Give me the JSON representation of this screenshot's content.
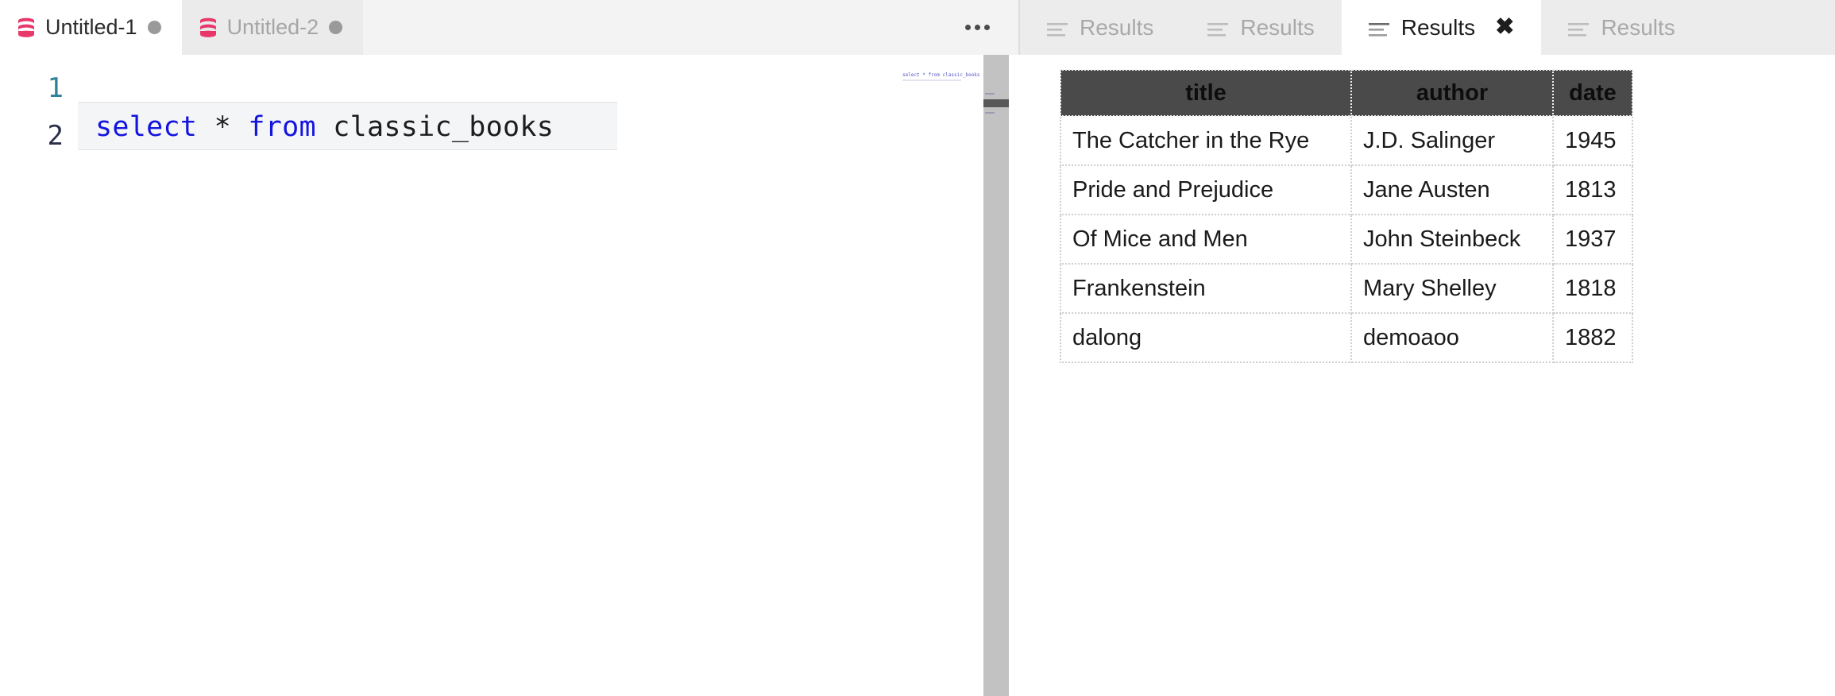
{
  "editor_tabs": [
    {
      "label": "Untitled-1",
      "icon": "database-icon",
      "modified": true,
      "active": true
    },
    {
      "label": "Untitled-2",
      "icon": "database-icon",
      "modified": true,
      "active": false
    }
  ],
  "editor_overflow": {
    "icon": "ellipsis-icon",
    "label": "..."
  },
  "result_tabs": [
    {
      "label": "Results",
      "icon": "list-icon",
      "active": false,
      "closable": false
    },
    {
      "label": "Results",
      "icon": "list-icon",
      "active": false,
      "closable": false
    },
    {
      "label": "Results",
      "icon": "list-icon",
      "active": true,
      "closable": true,
      "close_label": "✖"
    },
    {
      "label": "Results",
      "icon": "list-icon",
      "active": false,
      "closable": false
    }
  ],
  "editor": {
    "line_numbers": [
      "1",
      "2"
    ],
    "lines": [
      {
        "number": "1",
        "text": "",
        "current": true
      },
      {
        "number": "2",
        "text": "select * from classic_books",
        "current": false
      }
    ],
    "tokens_line2": {
      "keyword1": "select",
      "star": "*",
      "keyword2": "from",
      "identifier": "classic_books"
    },
    "minimap_text": "select * from classic_books"
  },
  "results_table": {
    "columns": [
      "title",
      "author",
      "date"
    ],
    "rows": [
      {
        "title": "The Catcher in the Rye",
        "author": "J.D. Salinger",
        "date": "1945"
      },
      {
        "title": "Pride and Prejudice",
        "author": "Jane Austen",
        "date": "1813"
      },
      {
        "title": "Of Mice and Men",
        "author": "John Steinbeck",
        "date": "1937"
      },
      {
        "title": "Frankenstein",
        "author": "Mary Shelley",
        "date": "1818"
      },
      {
        "title": "dalong",
        "author": "demoaoo",
        "date": "1882"
      }
    ]
  },
  "colors": {
    "accent_pink": "#e8386a",
    "keyword_blue": "#1414e0",
    "current_line_number": "#2f8099",
    "line_number": "#2b2f4a",
    "table_header_bg": "#4a4a4a",
    "tab_active_bg": "#ffffff",
    "tab_inactive_bg": "#ebebeb"
  }
}
